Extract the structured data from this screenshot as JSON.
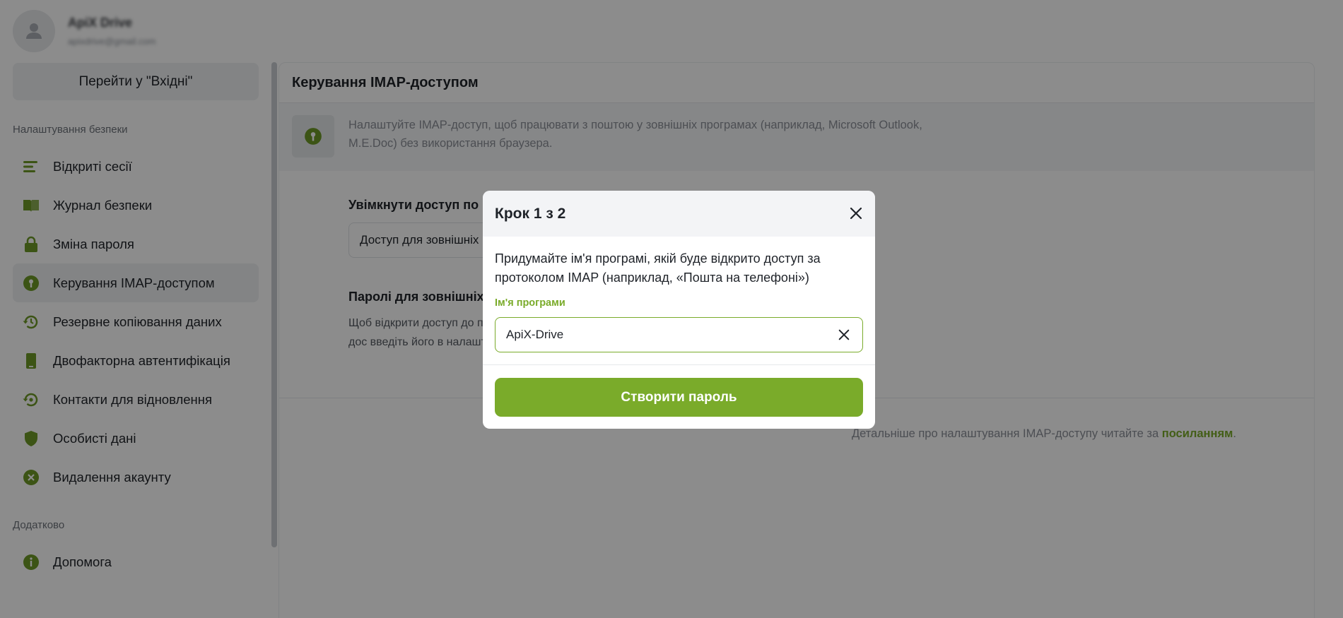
{
  "user": {
    "name": "ApiX Drive",
    "email": "apixdrive@gmail.com"
  },
  "sidebar": {
    "inbox_button": "Перейти у \"Вхідні\"",
    "security_section": "Налаштування безпеки",
    "items": [
      {
        "label": "Відкриті сесії",
        "icon": "list-icon"
      },
      {
        "label": "Журнал безпеки",
        "icon": "book-icon"
      },
      {
        "label": "Зміна пароля",
        "icon": "lock-icon"
      },
      {
        "label": "Керування IMAP-доступом",
        "icon": "key-circle-icon",
        "active": true
      },
      {
        "label": "Резервне копіювання даних",
        "icon": "backup-icon"
      },
      {
        "label": "Двофакторна автентифікація",
        "icon": "phone-icon"
      },
      {
        "label": "Контакти для відновлення",
        "icon": "recovery-icon"
      },
      {
        "label": "Особисті дані",
        "icon": "shield-icon"
      },
      {
        "label": "Видалення акаунту",
        "icon": "delete-circle-icon"
      }
    ],
    "extra_section": "Додатково",
    "extra_items": [
      {
        "label": "Допомога",
        "icon": "info-icon"
      }
    ]
  },
  "main": {
    "title": "Керування IMAP-доступом",
    "info_text": "Налаштуйте IMAP-доступ, щоб працювати з поштою у зовнішніх програмах (наприклад, Microsoft Outlook, M.E.Doc) без використання браузера.",
    "enable_title": "Увімкнути доступ по I",
    "select_value": "Доступ для зовнішніх",
    "passwords_title": "Паролі для зовнішніх п",
    "passwords_desc": "Щоб відкрити доступ до програми, увімкніть дос введіть його в налаштув",
    "footer_text": "Детальніше про налаштування IMAP-доступу читайте за ",
    "footer_link": "посиланням",
    "footer_end": "."
  },
  "modal": {
    "title": "Крок 1 з 2",
    "description": "Придумайте ім'я програмі, якій буде відкрито доступ за протоколом IMAP (наприклад, «Пошта на телефоні»)",
    "input_label": "Ім'я програми",
    "input_value": "ApiX-Drive",
    "submit_label": "Створити пароль"
  },
  "colors": {
    "accent": "#7aab2a",
    "overlay": "rgba(0,0,0,0.45)"
  }
}
